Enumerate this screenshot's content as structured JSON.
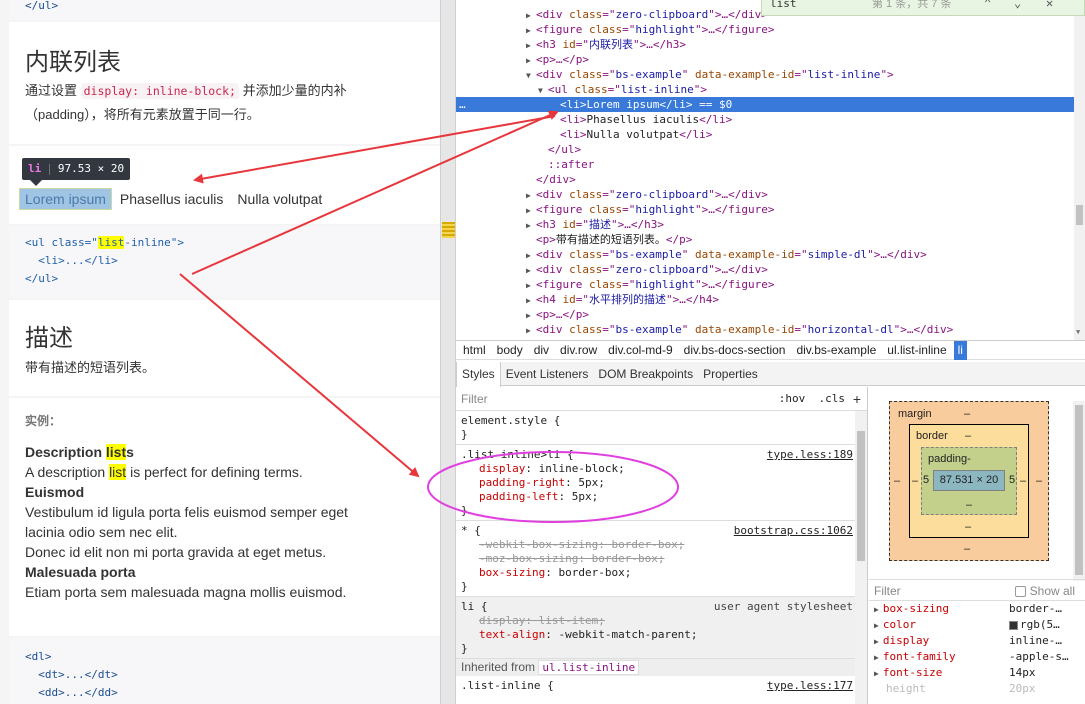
{
  "left": {
    "top_code": "</ul>",
    "section1_title": "内联列表",
    "section1_desc_pre": "通过设置 ",
    "section1_code": "display: inline-block;",
    "section1_desc_post": " 并添加少量的内补",
    "section1_desc_line2": "（padding），将所有元素放置于同一行。",
    "tooltip_tag": "li",
    "tooltip_size": "97.53 × 20",
    "inline_items": [
      "Lorem ipsum",
      "Phasellus iaculis",
      "Nulla volutpat"
    ],
    "code1_open_tag": "<ul class=\"",
    "code1_class_hl": "list",
    "code1_class_rest": "-inline\">",
    "code1_li": "  <li>...</li>",
    "code1_close": "</ul>",
    "section2_title": "描述",
    "section2_desc": "带有描述的短语列表。",
    "example_label": "实例：",
    "dl": {
      "t1_pre": "Description ",
      "t1_hl": "list",
      "t1_post": "s",
      "d1_pre": "A description ",
      "d1_hl": "list",
      "d1_post": " is perfect for defining terms.",
      "t2": "Euismod",
      "d2a": "Vestibulum id ligula porta felis euismod semper eget",
      "d2b": "lacinia odio sem nec elit.",
      "d2c": "Donec id elit non mi porta gravida at eget metus.",
      "t3": "Malesuada porta",
      "d3": "Etiam porta sem malesuada magna mollis euismod."
    },
    "code2": [
      "<dl>",
      "  <dt>...</dt>",
      "  <dd>...</dd>"
    ]
  },
  "find": {
    "query": "list",
    "count": "第 1 条，共 7 条"
  },
  "elements": [
    {
      "indent": 6,
      "tri": "▶",
      "parts": [
        [
          "t",
          "<div "
        ],
        [
          "a",
          "class"
        ],
        [
          "t",
          "=\""
        ],
        [
          "v",
          "zero-clipboard"
        ],
        [
          "t",
          "\">…</div>"
        ]
      ]
    },
    {
      "indent": 6,
      "tri": "▶",
      "parts": [
        [
          "t",
          "<figure "
        ],
        [
          "a",
          "class"
        ],
        [
          "t",
          "=\""
        ],
        [
          "v",
          "highlight"
        ],
        [
          "t",
          "\">…</figure>"
        ]
      ]
    },
    {
      "indent": 6,
      "tri": "▶",
      "parts": [
        [
          "t",
          "<h3 "
        ],
        [
          "a",
          "id"
        ],
        [
          "t",
          "=\""
        ],
        [
          "v",
          "内联列表"
        ],
        [
          "t",
          "\">…</h3>"
        ]
      ]
    },
    {
      "indent": 6,
      "tri": "▶",
      "parts": [
        [
          "t",
          "<p>…</p>"
        ]
      ]
    },
    {
      "indent": 6,
      "tri": "▼",
      "parts": [
        [
          "t",
          "<div "
        ],
        [
          "a",
          "class"
        ],
        [
          "t",
          "=\""
        ],
        [
          "v",
          "bs-example"
        ],
        [
          "t",
          "\" "
        ],
        [
          "a",
          "data-example-id"
        ],
        [
          "t",
          "=\""
        ],
        [
          "v",
          "list-inline"
        ],
        [
          "t",
          "\">"
        ]
      ]
    },
    {
      "indent": 7,
      "tri": "▼",
      "parts": [
        [
          "t",
          "<ul "
        ],
        [
          "a",
          "class"
        ],
        [
          "t",
          "=\""
        ],
        [
          "v",
          "list-inline"
        ],
        [
          "t",
          "\">"
        ]
      ]
    },
    {
      "indent": 8,
      "tri": "",
      "sel": true,
      "parts": [
        [
          "t",
          "<li>"
        ],
        [
          "x",
          "Lorem ipsum"
        ],
        [
          "t",
          "</li>"
        ],
        [
          "x",
          " == $0"
        ]
      ]
    },
    {
      "indent": 8,
      "tri": "",
      "parts": [
        [
          "t",
          "<li>"
        ],
        [
          "x",
          "Phasellus iaculis"
        ],
        [
          "t",
          "</li>"
        ]
      ]
    },
    {
      "indent": 8,
      "tri": "",
      "parts": [
        [
          "t",
          "<li>"
        ],
        [
          "x",
          "Nulla volutpat"
        ],
        [
          "t",
          "</li>"
        ]
      ]
    },
    {
      "indent": 7,
      "tri": "",
      "parts": [
        [
          "t",
          "</ul>"
        ]
      ]
    },
    {
      "indent": 7,
      "tri": "",
      "parts": [
        [
          "t",
          "::after"
        ]
      ]
    },
    {
      "indent": 6,
      "tri": "",
      "parts": [
        [
          "t",
          "</div>"
        ]
      ]
    },
    {
      "indent": 6,
      "tri": "▶",
      "parts": [
        [
          "t",
          "<div "
        ],
        [
          "a",
          "class"
        ],
        [
          "t",
          "=\""
        ],
        [
          "v",
          "zero-clipboard"
        ],
        [
          "t",
          "\">…</div>"
        ]
      ]
    },
    {
      "indent": 6,
      "tri": "▶",
      "parts": [
        [
          "t",
          "<figure "
        ],
        [
          "a",
          "class"
        ],
        [
          "t",
          "=\""
        ],
        [
          "v",
          "highlight"
        ],
        [
          "t",
          "\">…</figure>"
        ]
      ]
    },
    {
      "indent": 6,
      "tri": "▶",
      "parts": [
        [
          "t",
          "<h3 "
        ],
        [
          "a",
          "id"
        ],
        [
          "t",
          "=\""
        ],
        [
          "v",
          "描述"
        ],
        [
          "t",
          "\">…</h3>"
        ]
      ]
    },
    {
      "indent": 6,
      "tri": "",
      "parts": [
        [
          "t",
          "<p>"
        ],
        [
          "x",
          "带有描述的短语列表。"
        ],
        [
          "t",
          "</p>"
        ]
      ]
    },
    {
      "indent": 6,
      "tri": "▶",
      "parts": [
        [
          "t",
          "<div "
        ],
        [
          "a",
          "class"
        ],
        [
          "t",
          "=\""
        ],
        [
          "v",
          "bs-example"
        ],
        [
          "t",
          "\" "
        ],
        [
          "a",
          "data-example-id"
        ],
        [
          "t",
          "=\""
        ],
        [
          "v",
          "simple-dl"
        ],
        [
          "t",
          "\">…</div>"
        ]
      ]
    },
    {
      "indent": 6,
      "tri": "▶",
      "parts": [
        [
          "t",
          "<div "
        ],
        [
          "a",
          "class"
        ],
        [
          "t",
          "=\""
        ],
        [
          "v",
          "zero-clipboard"
        ],
        [
          "t",
          "\">…</div>"
        ]
      ]
    },
    {
      "indent": 6,
      "tri": "▶",
      "parts": [
        [
          "t",
          "<figure "
        ],
        [
          "a",
          "class"
        ],
        [
          "t",
          "=\""
        ],
        [
          "v",
          "highlight"
        ],
        [
          "t",
          "\">…</figure>"
        ]
      ]
    },
    {
      "indent": 6,
      "tri": "▶",
      "parts": [
        [
          "t",
          "<h4 "
        ],
        [
          "a",
          "id"
        ],
        [
          "t",
          "=\""
        ],
        [
          "v",
          "水平排列的描述"
        ],
        [
          "t",
          "\">…</h4>"
        ]
      ]
    },
    {
      "indent": 6,
      "tri": "▶",
      "parts": [
        [
          "t",
          "<p>…</p>"
        ]
      ]
    },
    {
      "indent": 6,
      "tri": "▶",
      "parts": [
        [
          "t",
          "<div "
        ],
        [
          "a",
          "class"
        ],
        [
          "t",
          "=\""
        ],
        [
          "v",
          "bs-example"
        ],
        [
          "t",
          "\" "
        ],
        [
          "a",
          "data-example-id"
        ],
        [
          "t",
          "=\""
        ],
        [
          "v",
          "horizontal-dl"
        ],
        [
          "t",
          "\">…</div>"
        ]
      ]
    }
  ],
  "selected_marker": "…",
  "breadcrumbs": [
    "html",
    "body",
    "div",
    "div.row",
    "div.col-md-9",
    "div.bs-docs-section",
    "div.bs-example",
    "ul.list-inline",
    "li"
  ],
  "subtabs": [
    "Styles",
    "Event Listeners",
    "DOM Breakpoints",
    "Properties"
  ],
  "styles": {
    "filter_placeholder": "Filter",
    "hov": ":hov",
    "cls": ".cls",
    "plus": "+",
    "element_style": "element.style {",
    "close": "}",
    "rule1": {
      "selector": ".list-inline>li {",
      "source": "type.less:189",
      "decls": [
        [
          "display",
          "inline-block"
        ],
        [
          "padding-right",
          "5px"
        ],
        [
          "padding-left",
          "5px"
        ]
      ]
    },
    "rule2": {
      "selector": "* {",
      "source": "bootstrap.css:1062",
      "decls_struck": [
        [
          "-webkit-box-sizing",
          "border-box"
        ],
        [
          "-moz-box-sizing",
          "border-box"
        ]
      ],
      "decls": [
        [
          "box-sizing",
          "border-box"
        ]
      ]
    },
    "rule3": {
      "selector": "li {",
      "source": "user agent stylesheet",
      "decls_struck": [
        [
          "display",
          "list-item"
        ]
      ],
      "decls": [
        [
          "text-align",
          "-webkit-match-parent"
        ]
      ]
    },
    "inherited_label": "Inherited from ",
    "inherited_from": "ul.list-inline",
    "rule4_selector": ".list-inline {",
    "rule4_source": "type.less:177"
  },
  "boxmodel": {
    "margin_label": "margin",
    "margin_val": "–",
    "border_label": "border",
    "border_val": "–",
    "padding_label": "padding-",
    "content": "87.531 × 20",
    "pad_left": "5",
    "pad_right": "5",
    "dash": "–"
  },
  "computed": {
    "filter_placeholder": "Filter",
    "show_all": "Show all",
    "rows": [
      {
        "prop": "box-sizing",
        "val": "border-…"
      },
      {
        "prop": "color",
        "val": "rgb(5…",
        "swatch": true
      },
      {
        "prop": "display",
        "val": "inline-…"
      },
      {
        "prop": "font-family",
        "val": "-apple-s…"
      },
      {
        "prop": "font-size",
        "val": "14px"
      },
      {
        "prop": "height",
        "val": "20px",
        "faded": true
      }
    ]
  },
  "colors": {
    "selection": "#3879d9",
    "annotation": "#e8363d",
    "highlight_circle": "#e040e0"
  }
}
